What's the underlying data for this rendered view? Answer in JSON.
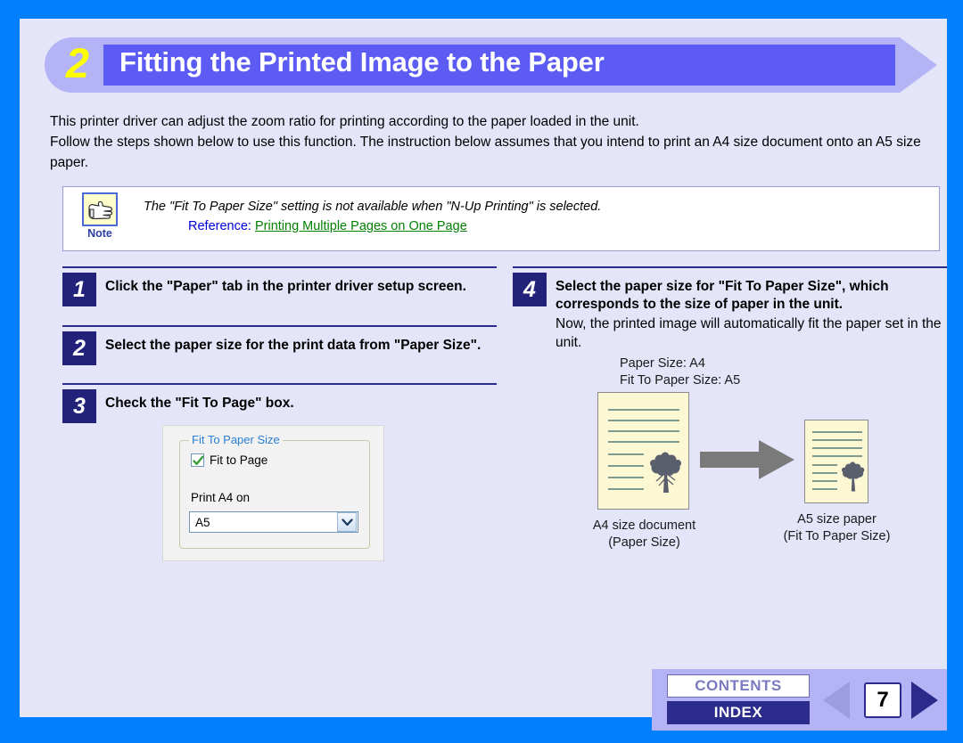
{
  "header": {
    "number": "2",
    "title": "Fitting the Printed Image to the Paper"
  },
  "intro": {
    "line1": "This printer driver can adjust the zoom ratio for printing according to the paper loaded in the unit.",
    "line2": "Follow the steps shown below to use this function. The instruction below assumes that you intend to print an A4 size document onto an A5 size paper."
  },
  "note": {
    "icon": "pointing-hand-icon",
    "label": "Note",
    "text": "The \"Fit To Paper Size\" setting is not available when \"N-Up Printing\" is selected.",
    "reference_label": "Reference:",
    "reference_link": "Printing Multiple Pages on One Page"
  },
  "steps_left": [
    {
      "number": "1",
      "text": "Click the \"Paper\" tab in the printer driver setup screen."
    },
    {
      "number": "2",
      "text": "Select the paper size for the print data from \"Paper Size\"."
    },
    {
      "number": "3",
      "text": "Check the \"Fit To Page\" box."
    }
  ],
  "steps_right": [
    {
      "number": "4",
      "text": "Select the paper size for \"Fit To Paper Size\", which corresponds to the size of paper in the unit.",
      "subtext": "Now, the printed image will automatically fit the paper set in the unit."
    }
  ],
  "dialog": {
    "groupbox_legend": "Fit To Paper Size",
    "checkbox_label": "Fit to Page",
    "checkbox_checked": true,
    "print_label": "Print A4 on",
    "combo_value": "A5",
    "combo_icon": "chevron-down-icon"
  },
  "illustration": {
    "caption_top_line1": "Paper Size: A4",
    "caption_top_line2": "Fit To Paper Size: A5",
    "a4_caption_line1": "A4 size document",
    "a4_caption_line2": "(Paper Size)",
    "a5_caption_line1": "A5 size paper",
    "a5_caption_line2": "(Fit To Paper Size)",
    "arrow_icon": "right-arrow-icon"
  },
  "nav": {
    "contents_label": "CONTENTS",
    "index_label": "INDEX",
    "page_number": "7",
    "prev_icon": "triangle-left-icon",
    "next_icon": "triangle-right-icon"
  },
  "colors": {
    "page_border": "#0080ff",
    "sheet_bg": "#e4e5f9",
    "banner_outer": "#b3b3f5",
    "banner_bar": "#5c5cf5",
    "banner_number": "#ffff00",
    "step_num_bg": "#22227a",
    "link_green": "#008000",
    "reference_blue": "#0000dd",
    "doc_paper": "#fdf8d4",
    "arrow_gray": "#7a7a7a",
    "nav_bg": "#b3b3f5",
    "index_bg": "#2b2b8c"
  }
}
